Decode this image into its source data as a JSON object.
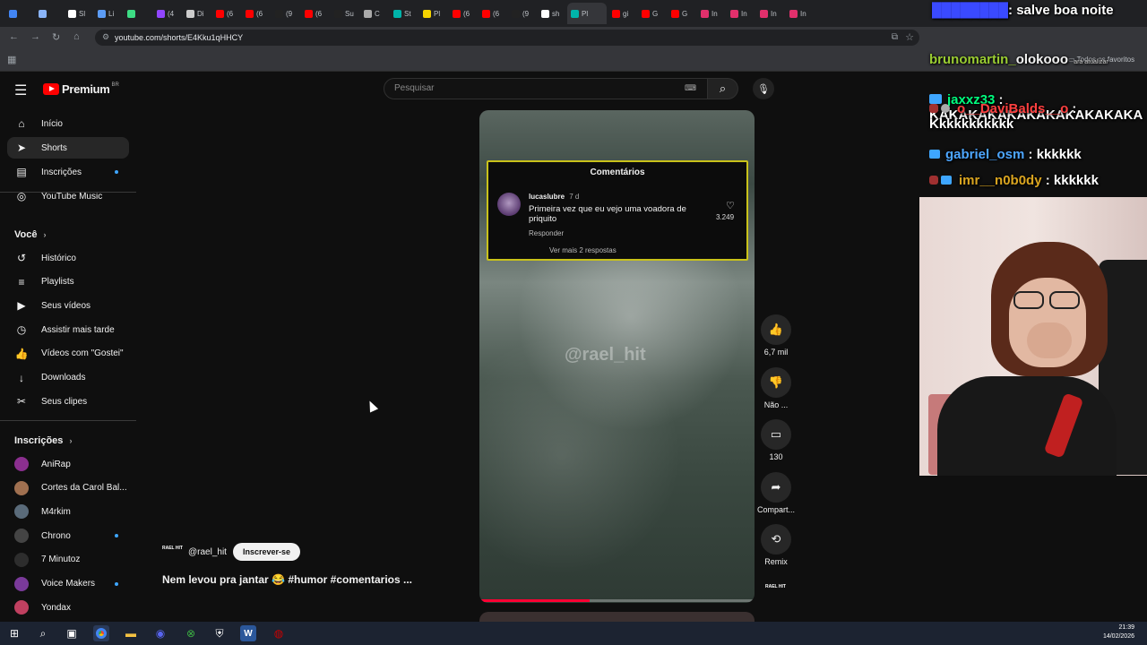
{
  "browser": {
    "tabs": [
      {
        "label": "",
        "color": "#4285f4"
      },
      {
        "label": "",
        "color": "#8ab4f8"
      },
      {
        "label": "Sl",
        "color": "#ffffff"
      },
      {
        "label": "Li",
        "color": "#5c9cf5"
      },
      {
        "label": "",
        "color": "#3ddc84"
      },
      {
        "label": "(4",
        "color": "#9146ff"
      },
      {
        "label": "Di",
        "color": "#cccccc"
      },
      {
        "label": "(6",
        "color": "#ff0000"
      },
      {
        "label": "(6",
        "color": "#ff0000"
      },
      {
        "label": "(9",
        "color": "#222222"
      },
      {
        "label": "(6",
        "color": "#ff0000"
      },
      {
        "label": "Su",
        "color": "#222222"
      },
      {
        "label": "C",
        "color": "#aaaaaa"
      },
      {
        "label": "St",
        "color": "#00b4aa"
      },
      {
        "label": "Pl",
        "color": "#f5d300"
      },
      {
        "label": "(6",
        "color": "#ff0000"
      },
      {
        "label": "(6",
        "color": "#ff0000"
      },
      {
        "label": "(9",
        "color": "#222222"
      },
      {
        "label": "sh",
        "color": "#ffffff"
      },
      {
        "label": "Pl",
        "color": "#00b4aa"
      },
      {
        "label": "gi",
        "color": "#ff0000"
      },
      {
        "label": "G",
        "color": "#ff0000"
      },
      {
        "label": "G",
        "color": "#ff0000"
      },
      {
        "label": "In",
        "color": "#e1306c"
      },
      {
        "label": "In",
        "color": "#e1306c"
      },
      {
        "label": "In",
        "color": "#e1306c"
      },
      {
        "label": "In",
        "color": "#e1306c"
      }
    ],
    "url": "youtube.com/shorts/E4Kku1qHHCY",
    "bookmarks_label": "Todos os favoritos"
  },
  "sidebar": {
    "logo_text": "Premium",
    "logo_badge": "BR",
    "main_items": [
      {
        "label": "Início",
        "icon": "home-icon",
        "glyph": "⌂"
      },
      {
        "label": "Shorts",
        "icon": "shorts-icon",
        "glyph": "➤"
      },
      {
        "label": "Inscrições",
        "icon": "subscriptions-icon",
        "glyph": "▤"
      },
      {
        "label": "YouTube Music",
        "icon": "music-icon",
        "glyph": "◎"
      }
    ],
    "you_heading": "Você",
    "you_items": [
      {
        "label": "Histórico",
        "icon": "history-icon",
        "glyph": "↺"
      },
      {
        "label": "Playlists",
        "icon": "playlists-icon",
        "glyph": "≡"
      },
      {
        "label": "Seus vídeos",
        "icon": "your-videos-icon",
        "glyph": "▶"
      },
      {
        "label": "Assistir mais tarde",
        "icon": "watch-later-icon",
        "glyph": "◷"
      },
      {
        "label": "Vídeos com \"Gostei\"",
        "icon": "liked-icon",
        "glyph": "👍"
      },
      {
        "label": "Downloads",
        "icon": "download-icon",
        "glyph": "↓"
      },
      {
        "label": "Seus clipes",
        "icon": "clips-icon",
        "glyph": "✂"
      }
    ],
    "subs_heading": "Inscrições",
    "subs": [
      {
        "label": "AniRap",
        "color": "#8b2f8f",
        "new": false
      },
      {
        "label": "Cortes da Carol Bal...",
        "color": "#a07050",
        "new": false
      },
      {
        "label": "M4rkim",
        "color": "#5a6b7a",
        "new": false
      },
      {
        "label": "Chrono",
        "color": "#444444",
        "new": true
      },
      {
        "label": "7 Minutoz",
        "color": "#2d2d2d",
        "new": false
      },
      {
        "label": "Voice Makers",
        "color": "#7a3a9a",
        "new": true
      },
      {
        "label": "Yondax",
        "color": "#c04060",
        "new": false
      }
    ]
  },
  "search": {
    "placeholder": "Pesquisar"
  },
  "short": {
    "comments_title": "Comentários",
    "comment_user": "lucaslubre",
    "comment_age": "7 d",
    "comment_text": "Primeira vez que eu vejo uma voadora de priquito",
    "comment_reply": "Responder",
    "comment_likes": "3.249",
    "comment_more": "Ver mais 2 respostas",
    "watermark": "@rael_hit",
    "channel": "@rael_hit",
    "subscribe_label": "Inscrever-se",
    "title": "Nem levou pra jantar 😂 #humor #comentarios ...",
    "progress": 0.4
  },
  "actions": [
    {
      "label": "6,7 mil",
      "icon": "like-icon",
      "glyph": "👍"
    },
    {
      "label": "Não ...",
      "icon": "dislike-icon",
      "glyph": "👎"
    },
    {
      "label": "130",
      "icon": "comments-icon",
      "glyph": "▭"
    },
    {
      "label": "Compart...",
      "icon": "share-icon",
      "glyph": "➦"
    },
    {
      "label": "Remix",
      "icon": "remix-icon",
      "glyph": "⟲"
    }
  ],
  "chat": {
    "top_right": ": salve boa noite",
    "msg0_user": "brunomartin_",
    "msg0_text": "olokooo",
    "msg0_extra": "ara atualizar",
    "msg1_user": "jaxxz33",
    "msg1_text": "KAKAKAKAKAKAKAKAKAKAKA",
    "msg2_user": "o__DaviBalds__o",
    "msg2_text": "Kkkkkkkkkkk",
    "msg3_user": "gabriel_osm",
    "msg3_text": "kkkkkk",
    "msg4_user": "imr__n0b0dy",
    "msg4_text": "kkkkkk",
    "colors": {
      "msg0": "#9acd32",
      "msg1": "#00ff7f",
      "msg2": "#ff4040",
      "msg3": "#4da6ff",
      "msg4": "#daa520"
    }
  },
  "taskbar": {
    "time": "21:39",
    "date": "14/02/2026"
  }
}
